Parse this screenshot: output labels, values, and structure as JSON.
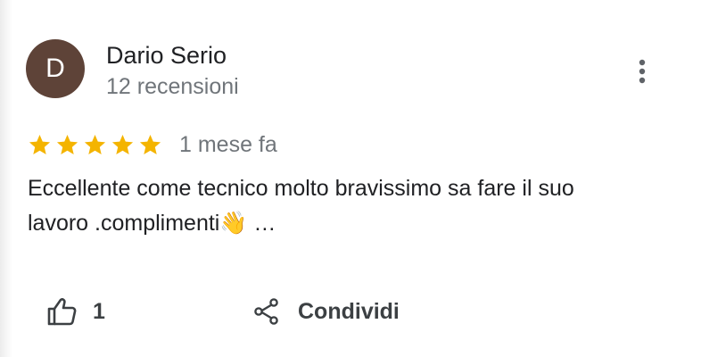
{
  "reviewer": {
    "initial": "D",
    "name": "Dario Serio",
    "reviews_count": "12 recensioni",
    "avatar_color": "#5e4338"
  },
  "review": {
    "rating": 5,
    "max_rating": 5,
    "date": "1 mese fa",
    "text_line1": "Eccellente come tecnico molto bravissimo sa fare il suo",
    "text_line2": "lavoro .complimenti👋 …"
  },
  "actions": {
    "like_count": "1",
    "share_label": "Condividi",
    "like_icon": "thumbs-up-icon",
    "share_icon": "share-icon",
    "more_icon": "more-vert-icon"
  },
  "colors": {
    "star": "#f4b400",
    "secondary_text": "#70757a",
    "primary_text": "#202124"
  }
}
